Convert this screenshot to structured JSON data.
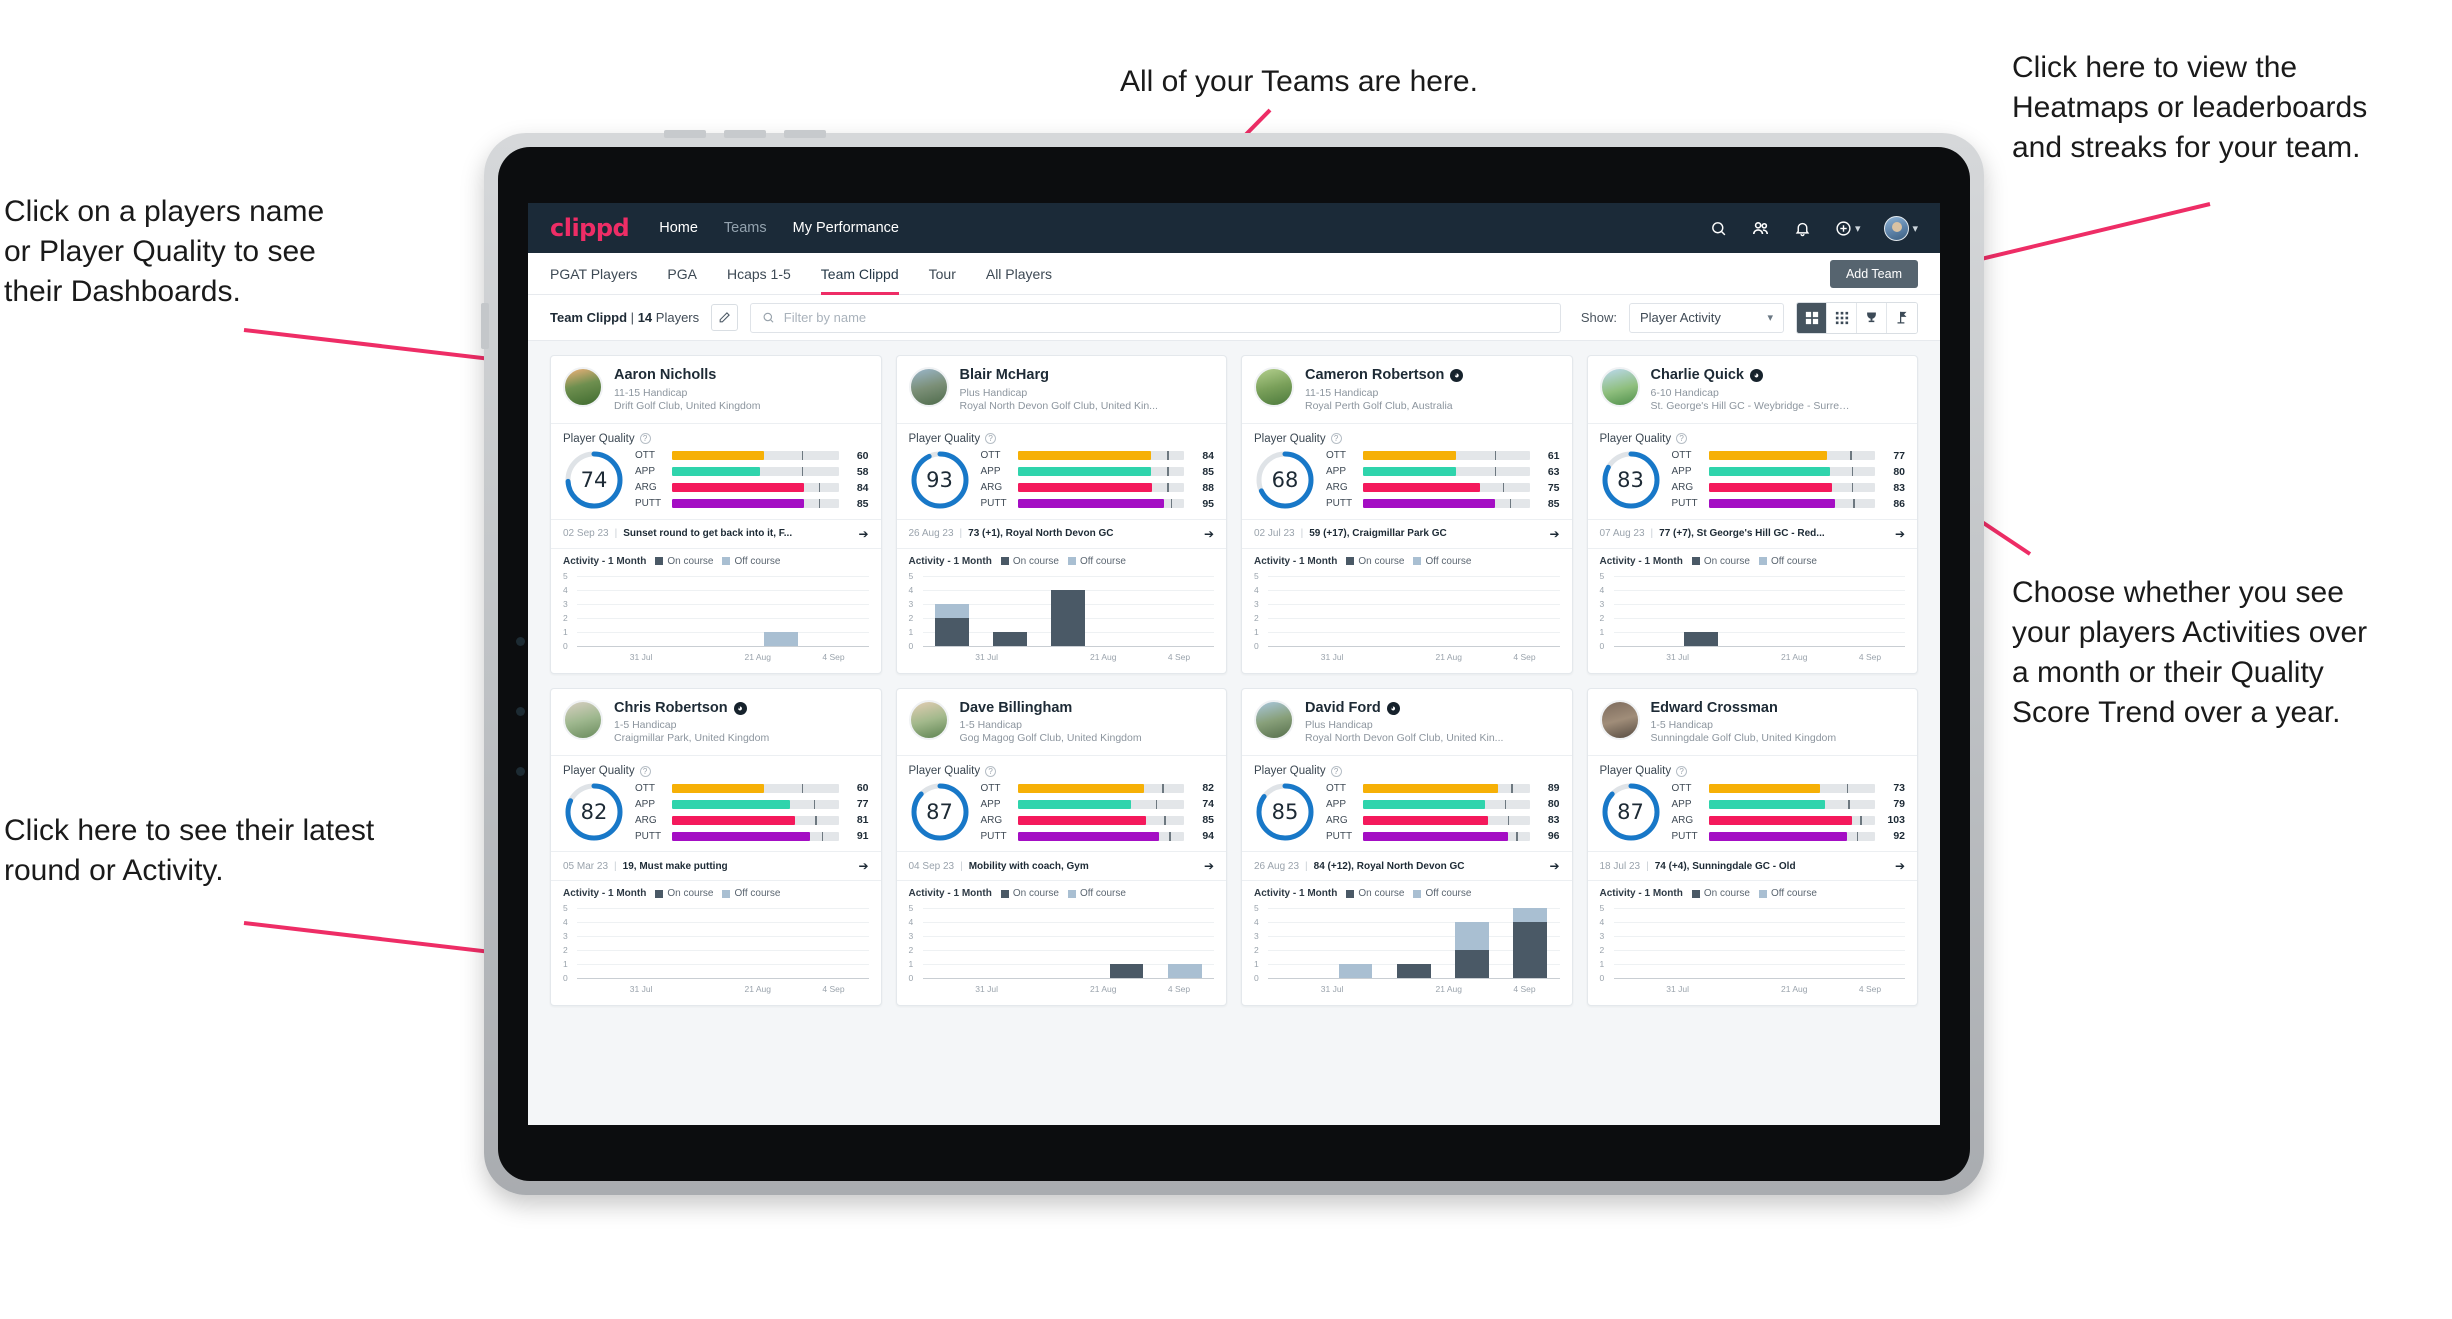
{
  "annotations": [
    {
      "id": "teams",
      "text": "All of your Teams are here."
    },
    {
      "id": "heatmaps",
      "text": "Click here to view the\nHeatmaps or leaderboards\nand streaks for your team."
    },
    {
      "id": "players",
      "text": "Click on a players name\nor Player Quality to see\ntheir Dashboards."
    },
    {
      "id": "activity-choice",
      "text": "Choose whether you see\nyour players Activities over\na month or their Quality\nScore Trend over a year."
    },
    {
      "id": "latest-round",
      "text": "Click here to see their latest\nround or Activity."
    }
  ],
  "nav": {
    "logo": "clippd",
    "links": [
      {
        "label": "Home",
        "active": true
      },
      {
        "label": "Teams",
        "active": false
      },
      {
        "label": "My Performance",
        "active": true
      }
    ],
    "icons": [
      "search-icon",
      "people-icon",
      "bell-icon",
      "plus-circle-icon",
      "avatar"
    ]
  },
  "tabs": [
    {
      "label": "PGAT Players",
      "active": false
    },
    {
      "label": "PGA",
      "active": false
    },
    {
      "label": "Hcaps 1-5",
      "active": false
    },
    {
      "label": "Team Clippd",
      "active": true
    },
    {
      "label": "Tour",
      "active": false
    },
    {
      "label": "All Players",
      "active": false
    }
  ],
  "add_team_label": "Add Team",
  "toolbar": {
    "team_name": "Team Clippd",
    "team_count": "14",
    "players_word": "Players",
    "separator": "|",
    "search_placeholder": "Filter by name",
    "search_value": "",
    "show_label": "Show:",
    "show_value": "Player Activity",
    "view_buttons": [
      "grid-view-icon",
      "dense-grid-icon",
      "trophy-icon",
      "flag-icon"
    ]
  },
  "card_labels": {
    "quality_title": "Player Quality",
    "activity_title": "Activity - 1 Month",
    "legend_on": "On course",
    "legend_off": "Off course",
    "metric_names": [
      "OTT",
      "APP",
      "ARG",
      "PUTT"
    ],
    "y_ticks": [
      "5",
      "4",
      "3",
      "2",
      "1",
      "0"
    ],
    "x_ticks": [
      "31 Jul",
      "21 Aug",
      "4 Sep"
    ]
  },
  "metric_colors": {
    "OTT": "#f6b006",
    "APP": "#2fd4ac",
    "ARG": "#f4195c",
    "PUTT": "#a40ec4",
    "ring": "#1878c8",
    "ring_track": "#dfe3e7"
  },
  "players": [
    {
      "name": "Aaron Nicholls",
      "verified": false,
      "handicap": "11-15 Handicap",
      "club": "Drift Golf Club, United Kingdom",
      "quality": 74,
      "metrics": [
        {
          "name": "OTT",
          "value": 60,
          "fill_pct": 55,
          "tick_pct": 78
        },
        {
          "name": "APP",
          "value": 58,
          "fill_pct": 53,
          "tick_pct": 78
        },
        {
          "name": "ARG",
          "value": 84,
          "fill_pct": 79,
          "tick_pct": 88
        },
        {
          "name": "PUTT",
          "value": 85,
          "fill_pct": 79,
          "tick_pct": 88
        }
      ],
      "round": {
        "date": "02 Sep 23",
        "text": "Sunset round to get back into it, F..."
      },
      "activity": [
        {
          "on": 0,
          "off": 0
        },
        {
          "on": 0,
          "off": 0
        },
        {
          "on": 0,
          "off": 0
        },
        {
          "on": 0,
          "off": 1
        },
        {
          "on": 0,
          "off": 0
        }
      ]
    },
    {
      "name": "Blair McHarg",
      "verified": false,
      "handicap": "Plus Handicap",
      "club": "Royal North Devon Golf Club, United Kin...",
      "quality": 93,
      "metrics": [
        {
          "name": "OTT",
          "value": 84,
          "fill_pct": 80,
          "tick_pct": 90
        },
        {
          "name": "APP",
          "value": 85,
          "fill_pct": 80,
          "tick_pct": 90
        },
        {
          "name": "ARG",
          "value": 88,
          "fill_pct": 81,
          "tick_pct": 90
        },
        {
          "name": "PUTT",
          "value": 95,
          "fill_pct": 88,
          "tick_pct": 92
        }
      ],
      "round": {
        "date": "26 Aug 23",
        "text": "73 (+1), Royal North Devon GC"
      },
      "activity": [
        {
          "on": 2,
          "off": 1
        },
        {
          "on": 1,
          "off": 0
        },
        {
          "on": 4,
          "off": 0
        },
        {
          "on": 0,
          "off": 0
        },
        {
          "on": 0,
          "off": 0
        }
      ]
    },
    {
      "name": "Cameron Robertson",
      "verified": true,
      "handicap": "11-15 Handicap",
      "club": "Royal Perth Golf Club, Australia",
      "quality": 68,
      "metrics": [
        {
          "name": "OTT",
          "value": 61,
          "fill_pct": 56,
          "tick_pct": 79
        },
        {
          "name": "APP",
          "value": 63,
          "fill_pct": 56,
          "tick_pct": 79
        },
        {
          "name": "ARG",
          "value": 75,
          "fill_pct": 70,
          "tick_pct": 84
        },
        {
          "name": "PUTT",
          "value": 85,
          "fill_pct": 79,
          "tick_pct": 88
        }
      ],
      "round": {
        "date": "02 Jul 23",
        "text": "59 (+17), Craigmillar Park GC"
      },
      "activity": [
        {
          "on": 0,
          "off": 0
        },
        {
          "on": 0,
          "off": 0
        },
        {
          "on": 0,
          "off": 0
        },
        {
          "on": 0,
          "off": 0
        },
        {
          "on": 0,
          "off": 0
        }
      ]
    },
    {
      "name": "Charlie Quick",
      "verified": true,
      "handicap": "6-10 Handicap",
      "club": "St. George's Hill GC - Weybridge - Surrey, ...",
      "quality": 83,
      "metrics": [
        {
          "name": "OTT",
          "value": 77,
          "fill_pct": 71,
          "tick_pct": 85
        },
        {
          "name": "APP",
          "value": 80,
          "fill_pct": 73,
          "tick_pct": 86
        },
        {
          "name": "ARG",
          "value": 83,
          "fill_pct": 74,
          "tick_pct": 86
        },
        {
          "name": "PUTT",
          "value": 86,
          "fill_pct": 76,
          "tick_pct": 87
        }
      ],
      "round": {
        "date": "07 Aug 23",
        "text": "77 (+7), St George's Hill GC - Red..."
      },
      "activity": [
        {
          "on": 0,
          "off": 0
        },
        {
          "on": 1,
          "off": 0
        },
        {
          "on": 0,
          "off": 0
        },
        {
          "on": 0,
          "off": 0
        },
        {
          "on": 0,
          "off": 0
        }
      ]
    },
    {
      "name": "Chris Robertson",
      "verified": true,
      "handicap": "1-5 Handicap",
      "club": "Craigmillar Park, United Kingdom",
      "quality": 82,
      "metrics": [
        {
          "name": "OTT",
          "value": 60,
          "fill_pct": 55,
          "tick_pct": 78
        },
        {
          "name": "APP",
          "value": 77,
          "fill_pct": 71,
          "tick_pct": 85
        },
        {
          "name": "ARG",
          "value": 81,
          "fill_pct": 74,
          "tick_pct": 86
        },
        {
          "name": "PUTT",
          "value": 91,
          "fill_pct": 83,
          "tick_pct": 90
        }
      ],
      "round": {
        "date": "05 Mar 23",
        "text": "19, Must make putting"
      },
      "activity": [
        {
          "on": 0,
          "off": 0
        },
        {
          "on": 0,
          "off": 0
        },
        {
          "on": 0,
          "off": 0
        },
        {
          "on": 0,
          "off": 0
        },
        {
          "on": 0,
          "off": 0
        }
      ]
    },
    {
      "name": "Dave Billingham",
      "verified": false,
      "handicap": "1-5 Handicap",
      "club": "Gog Magog Golf Club, United Kingdom",
      "quality": 87,
      "metrics": [
        {
          "name": "OTT",
          "value": 82,
          "fill_pct": 76,
          "tick_pct": 87
        },
        {
          "name": "APP",
          "value": 74,
          "fill_pct": 68,
          "tick_pct": 83
        },
        {
          "name": "ARG",
          "value": 85,
          "fill_pct": 77,
          "tick_pct": 88
        },
        {
          "name": "PUTT",
          "value": 94,
          "fill_pct": 85,
          "tick_pct": 91
        }
      ],
      "round": {
        "date": "04 Sep 23",
        "text": "Mobility with coach, Gym"
      },
      "activity": [
        {
          "on": 0,
          "off": 0
        },
        {
          "on": 0,
          "off": 0
        },
        {
          "on": 0,
          "off": 0
        },
        {
          "on": 1,
          "off": 0
        },
        {
          "on": 0,
          "off": 1
        }
      ]
    },
    {
      "name": "David Ford",
      "verified": true,
      "handicap": "Plus Handicap",
      "club": "Royal North Devon Golf Club, United Kin...",
      "quality": 85,
      "metrics": [
        {
          "name": "OTT",
          "value": 89,
          "fill_pct": 81,
          "tick_pct": 89
        },
        {
          "name": "APP",
          "value": 80,
          "fill_pct": 73,
          "tick_pct": 85
        },
        {
          "name": "ARG",
          "value": 83,
          "fill_pct": 75,
          "tick_pct": 87
        },
        {
          "name": "PUTT",
          "value": 96,
          "fill_pct": 87,
          "tick_pct": 92
        }
      ],
      "round": {
        "date": "26 Aug 23",
        "text": "84 (+12), Royal North Devon GC"
      },
      "activity": [
        {
          "on": 0,
          "off": 0
        },
        {
          "on": 0,
          "off": 1
        },
        {
          "on": 1,
          "off": 0
        },
        {
          "on": 2,
          "off": 2
        },
        {
          "on": 4,
          "off": 1
        }
      ]
    },
    {
      "name": "Edward Crossman",
      "verified": false,
      "handicap": "1-5 Handicap",
      "club": "Sunningdale Golf Club, United Kingdom",
      "quality": 87,
      "metrics": [
        {
          "name": "OTT",
          "value": 73,
          "fill_pct": 67,
          "tick_pct": 83
        },
        {
          "name": "APP",
          "value": 79,
          "fill_pct": 70,
          "tick_pct": 84
        },
        {
          "name": "ARG",
          "value": 103,
          "fill_pct": 86,
          "tick_pct": 91
        },
        {
          "name": "PUTT",
          "value": 92,
          "fill_pct": 83,
          "tick_pct": 89
        }
      ],
      "round": {
        "date": "18 Jul 23",
        "text": "74 (+4), Sunningdale GC - Old"
      },
      "activity": [
        {
          "on": 0,
          "off": 0
        },
        {
          "on": 0,
          "off": 0
        },
        {
          "on": 0,
          "off": 0
        },
        {
          "on": 0,
          "off": 0
        },
        {
          "on": 0,
          "off": 0
        }
      ]
    }
  ]
}
